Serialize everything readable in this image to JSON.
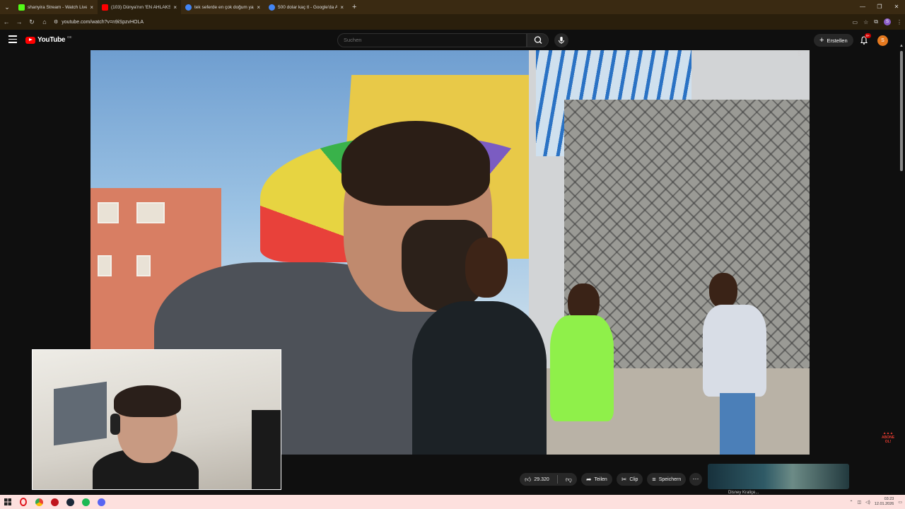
{
  "browser": {
    "tabs": [
      {
        "title": "shanyira Stream - Watch Live o",
        "favicon_color": "#53fc18",
        "active": false
      },
      {
        "title": "(103) Dünya'nın 'EN AHLAKSIZ'",
        "favicon_color": "#ff0000",
        "active": true
      },
      {
        "title": "tek seferde en çok doğum yapa",
        "favicon_color": "#4285f4",
        "active": false
      },
      {
        "title": "500 dolar kaç tl - Google'da Ar",
        "favicon_color": "#4285f4",
        "active": false
      }
    ],
    "url": "youtube.com/watch?v=n9iSpzvHOLA",
    "profile_initial": "S"
  },
  "youtube": {
    "logo_text": "YouTube",
    "country_code": "DE",
    "search_placeholder": "Suchen",
    "create_label": "Erstellen",
    "notification_badge": "9+",
    "avatar_initial": "S"
  },
  "video": {
    "overlay_number": "5"
  },
  "actions": {
    "like_count": "29.320",
    "share_label": "Teilen",
    "clip_label": "Clip",
    "save_label": "Speichern"
  },
  "sidebar_thumb": {
    "caption": "Disney Kraliçe..."
  },
  "subscribe_overlay": {
    "line1": "ABONE",
    "line2": "OL!"
  },
  "taskbar": {
    "time": "03:23",
    "date": "12.01.2026"
  },
  "colors": {
    "accent": "#ff0000",
    "avatar": "#e5791f",
    "taskbar": "#fde0de"
  }
}
